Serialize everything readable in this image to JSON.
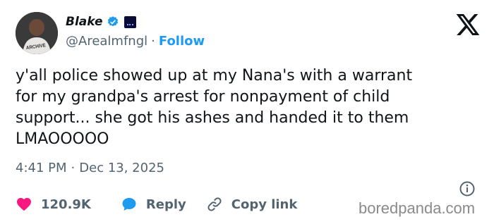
{
  "user": {
    "name": "Blake",
    "handle": "@Arealmfngl",
    "separator": "·",
    "follow_label": "Follow",
    "avatar_shirt_text": "ARCHIVE"
  },
  "tweet": {
    "lines": [
      "y'all police showed up at my Nana's with a warrant",
      "for my grandpa's arrest for nonpayment of child",
      "support... she got his ashes and handed it to them",
      "LMAOOOOO"
    ],
    "time": "4:41 PM",
    "date_separator": "·",
    "date": "Dec 13, 2025"
  },
  "actions": {
    "likes": "120.9K",
    "reply_label": "Reply",
    "copy_link_label": "Copy link"
  },
  "watermark": "boredpanda.com",
  "colors": {
    "text": "#0f1419",
    "muted": "#536471",
    "link_blue": "#1d9bf0",
    "like_red": "#f91880"
  },
  "icons": [
    "verified-badge-icon",
    "affiliate-badge-icon",
    "x-logo-icon",
    "info-icon",
    "heart-icon",
    "reply-bubble-icon",
    "link-icon"
  ]
}
